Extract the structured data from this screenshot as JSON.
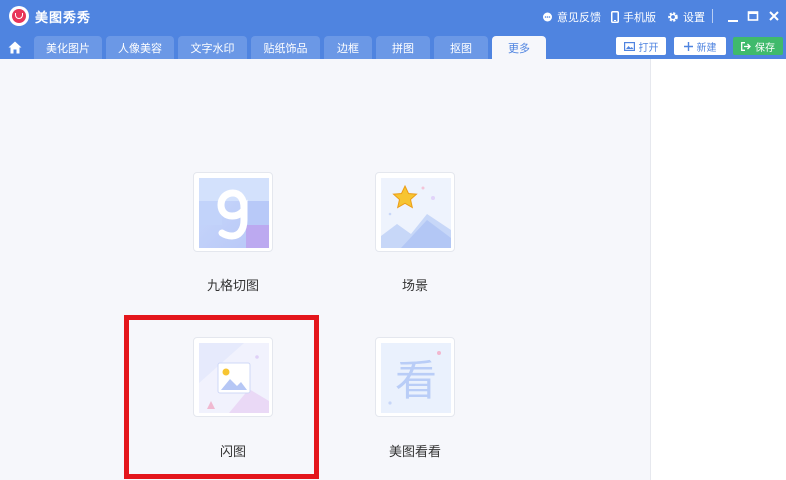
{
  "titlebar": {
    "app_name": "美图秀秀",
    "feedback": "意见反馈",
    "mobile": "手机版",
    "settings": "设置"
  },
  "tabs": [
    {
      "label": "美化图片"
    },
    {
      "label": "人像美容"
    },
    {
      "label": "文字水印"
    },
    {
      "label": "贴纸饰品"
    },
    {
      "label": "边框"
    },
    {
      "label": "拼图"
    },
    {
      "label": "抠图"
    },
    {
      "label": "更多",
      "active": true
    }
  ],
  "actions": {
    "open": "打开",
    "new": "新建",
    "save": "保存"
  },
  "tools": [
    {
      "label": "九格切图",
      "icon": "nine-grid-icon"
    },
    {
      "label": "场景",
      "icon": "scene-icon"
    },
    {
      "label": "闪图",
      "icon": "flash-image-icon"
    },
    {
      "label": "美图看看",
      "icon": "meitu-viewer-icon"
    }
  ],
  "viewer_glyph": "看",
  "colors": {
    "titlebar": "#4f84e0",
    "tab": "#6b98e6",
    "save": "#3fba6c",
    "highlight": "#e4161c"
  }
}
